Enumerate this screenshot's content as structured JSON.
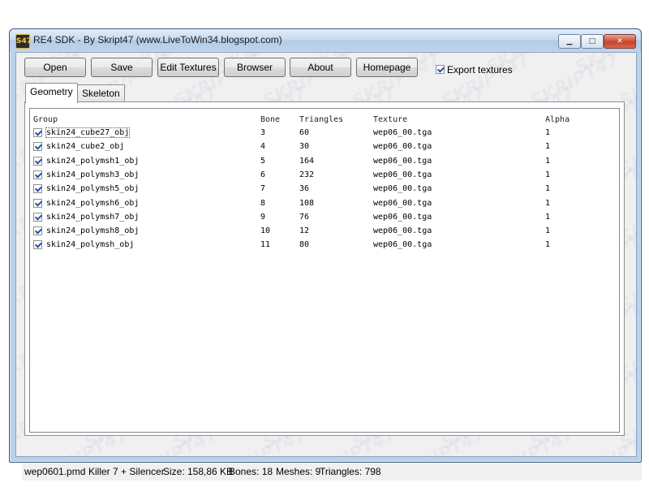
{
  "window": {
    "title": "RE4 SDK - By Skript47 (www.LiveToWin34.blogspot.com)",
    "icon_text": "S47",
    "min_glyph": "▁",
    "max_glyph": "□",
    "close_glyph": "✕"
  },
  "toolbar": {
    "buttons": [
      "Open",
      "Save",
      "Edit Textures",
      "Browser",
      "About",
      "Homepage"
    ],
    "export_textures_label": "Export textures",
    "export_textures_checked": true
  },
  "tabs": [
    {
      "label": "Geometry",
      "active": true
    },
    {
      "label": "Skeleton",
      "active": false
    }
  ],
  "table": {
    "columns": [
      "Group",
      "Bone",
      "Triangles",
      "Texture",
      "Alpha"
    ],
    "rows": [
      {
        "group": "skin24_cube27_obj",
        "bone": "3",
        "triangles": "60",
        "texture": "wep06_00.tga",
        "alpha": "1",
        "checked": true
      },
      {
        "group": "skin24_cube2_obj",
        "bone": "4",
        "triangles": "30",
        "texture": "wep06_00.tga",
        "alpha": "1",
        "checked": true
      },
      {
        "group": "skin24_polymsh1_obj",
        "bone": "5",
        "triangles": "164",
        "texture": "wep06_00.tga",
        "alpha": "1",
        "checked": true
      },
      {
        "group": "skin24_polymsh3_obj",
        "bone": "6",
        "triangles": "232",
        "texture": "wep06_00.tga",
        "alpha": "1",
        "checked": true
      },
      {
        "group": "skin24_polymsh5_obj",
        "bone": "7",
        "triangles": "36",
        "texture": "wep06_00.tga",
        "alpha": "1",
        "checked": true
      },
      {
        "group": "skin24_polymsh6_obj",
        "bone": "8",
        "triangles": "108",
        "texture": "wep06_00.tga",
        "alpha": "1",
        "checked": true
      },
      {
        "group": "skin24_polymsh7_obj",
        "bone": "9",
        "triangles": "76",
        "texture": "wep06_00.tga",
        "alpha": "1",
        "checked": true
      },
      {
        "group": "skin24_polymsh8_obj",
        "bone": "10",
        "triangles": "12",
        "texture": "wep06_00.tga",
        "alpha": "1",
        "checked": true
      },
      {
        "group": "skin24_polymsh_obj",
        "bone": "11",
        "triangles": "80",
        "texture": "wep06_00.tga",
        "alpha": "1",
        "checked": true
      }
    ]
  },
  "status": {
    "file": "wep0601.pmd",
    "name": "Killer 7 + Silencer",
    "size": "Size: 158,86 KB",
    "bones": "Bones: 18",
    "meshes": "Meshes: 9",
    "triangles": "Triangles: 798"
  },
  "watermark_text": "SKRIPT47",
  "colors": {
    "window_frame": "#b9d1ea",
    "client_bg": "#f0f0f0",
    "close_button": "#c9442b",
    "check_mark": "#2e52a8"
  }
}
